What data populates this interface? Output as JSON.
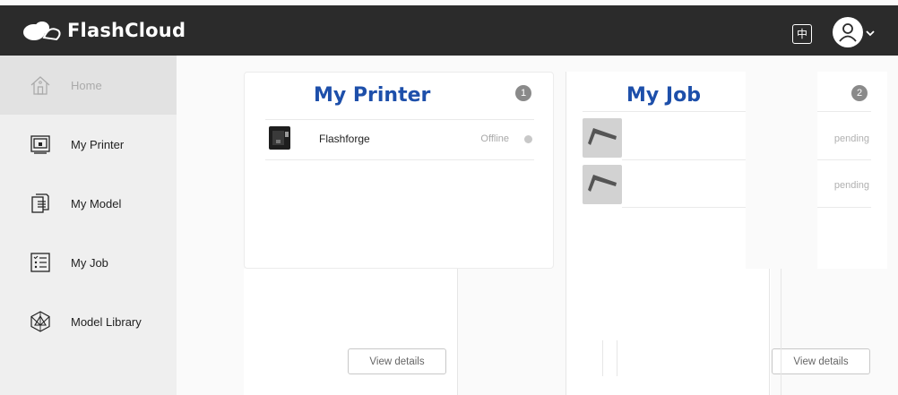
{
  "app": {
    "name": "FlashCloud",
    "logo_icon": "cloud-logo-icon",
    "language_icon": "chinese-language-icon",
    "language_glyph": "中",
    "user_icon": "user-avatar-icon"
  },
  "sidebar": {
    "items": [
      {
        "label": "Home",
        "icon": "home-icon",
        "active": true
      },
      {
        "label": "My Printer",
        "icon": "printer-icon",
        "active": false
      },
      {
        "label": "My Model",
        "icon": "model-icon",
        "active": false
      },
      {
        "label": "My Job",
        "icon": "job-list-icon",
        "active": false
      },
      {
        "label": "Model Library",
        "icon": "model-library-icon",
        "active": false
      }
    ]
  },
  "printer_card": {
    "title": "My Printer",
    "count": "1",
    "printers": [
      {
        "name": "Flashforge",
        "status": "Offline"
      }
    ],
    "view_details": "View details"
  },
  "job_card": {
    "title": "My Job",
    "count": "2",
    "jobs": [
      {
        "status": "pending"
      },
      {
        "status": "pending"
      }
    ],
    "view_details": "View details"
  },
  "colors": {
    "topbar": "#2b2b2b",
    "title_blue": "#1d4faa",
    "sidebar_bg": "#efefef",
    "sidebar_active": "#e2e2e2"
  }
}
